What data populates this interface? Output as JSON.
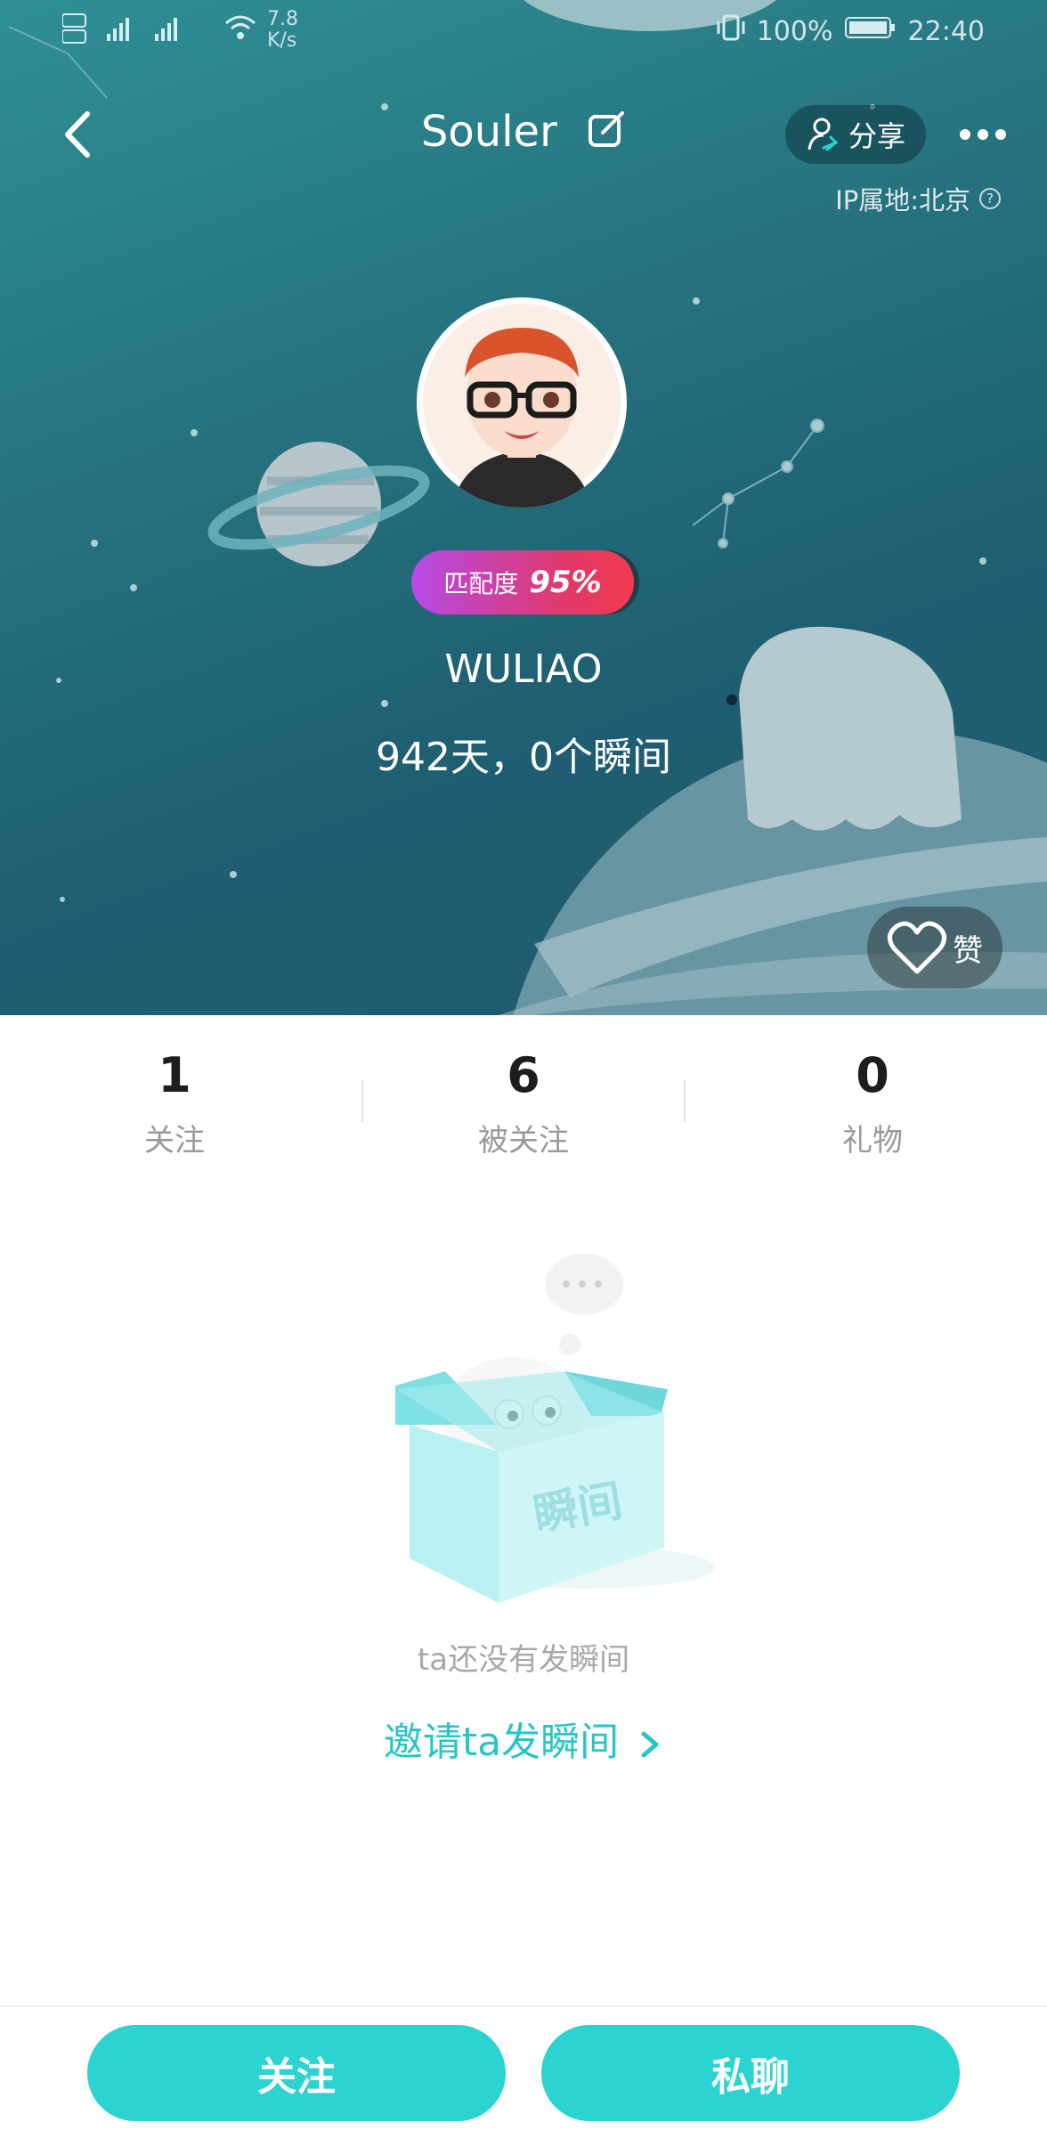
{
  "status_bar": {
    "speed_value": "7.8",
    "speed_unit": "K/s",
    "battery": "100%",
    "time": "22:40"
  },
  "header": {
    "title": "Souler",
    "share_label": "分享",
    "ip_location": "IP属地:北京",
    "ip_help": "?"
  },
  "profile": {
    "match_label": "匹配度",
    "match_value": "95%",
    "username": "WULIAO",
    "summary": "942天，0个瞬间",
    "like_label": "赞"
  },
  "stats": [
    {
      "value": "1",
      "label": "关注"
    },
    {
      "value": "6",
      "label": "被关注"
    },
    {
      "value": "0",
      "label": "礼物"
    }
  ],
  "empty_state": {
    "box_text": "瞬间",
    "message": "ta还没有发瞬间",
    "invite_label": "邀请ta发瞬间"
  },
  "actions": {
    "follow_label": "关注",
    "chat_label": "私聊"
  },
  "colors": {
    "accent": "#2bd3d1",
    "invite": "#27c6c6",
    "hero_top": "#2f8f96",
    "hero_bottom": "#1f5a6e"
  }
}
